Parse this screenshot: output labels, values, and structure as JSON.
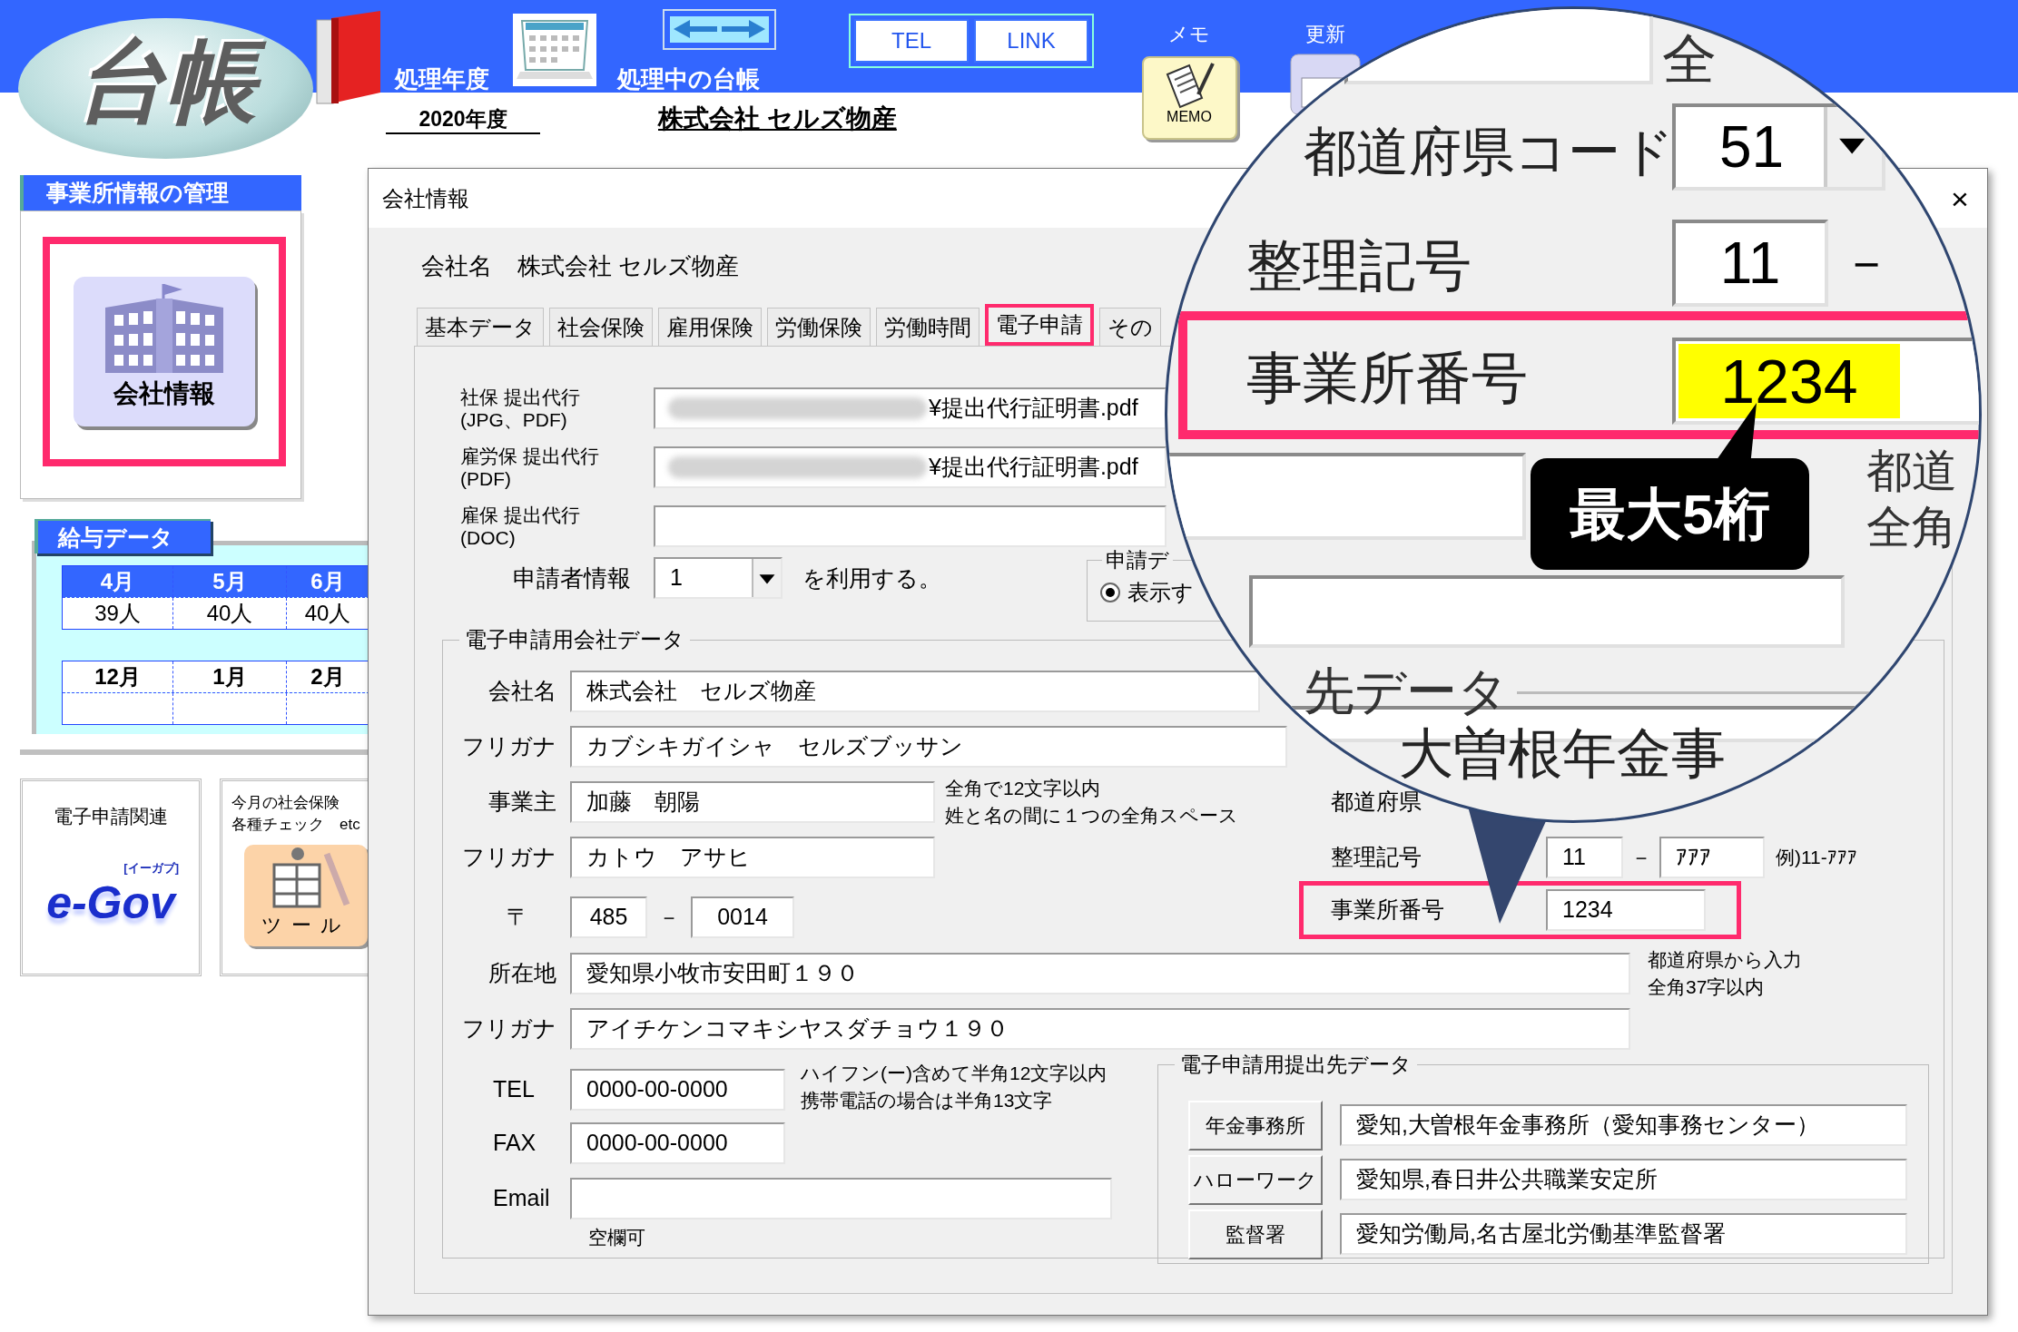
{
  "app_bar": {
    "logo": "台帳",
    "year_label": "処理年度",
    "year": "2020年度",
    "ledger_label": "処理中の台帳",
    "ledger": "株式会社 セルズ物産",
    "buttons": [
      "TEL",
      "LINK"
    ],
    "memo_label": "メモ",
    "memo_icon_text": "MEMO",
    "update_label": "更新"
  },
  "sidebar": {
    "office": {
      "title": "事業所情報の管理",
      "button": "会社情報",
      "highlighted": true
    },
    "salary": {
      "title": "給与データ",
      "tables": [
        {
          "months": [
            "4月",
            "5月",
            "6月"
          ],
          "counts": [
            "39人",
            "40人",
            "40人"
          ]
        },
        {
          "months": [
            "12月",
            "1月",
            "2月"
          ]
        }
      ]
    },
    "tiles": [
      {
        "kind": "egov",
        "caption": "電子申請関連",
        "logo": "e-Gov",
        "logo_note": "[イーガブ]"
      },
      {
        "kind": "tool",
        "lines": [
          "今月の社会保険",
          "各種チェック　etc"
        ],
        "icon_label": "ツール"
      }
    ]
  },
  "dialog": {
    "title": "会社情報",
    "close": "×",
    "company_label": "会社名",
    "company_name": "株式会社 セルズ物産",
    "tabs": [
      {
        "label": "基本データ",
        "selected": false
      },
      {
        "label": "社会保険",
        "selected": false
      },
      {
        "label": "雇用保険",
        "selected": false
      },
      {
        "label": "労働保険",
        "selected": false
      },
      {
        "label": "労働時間",
        "selected": false
      },
      {
        "label": "電子申請",
        "selected": true
      },
      {
        "label": "その",
        "selected": false
      }
    ],
    "proxy_files": [
      {
        "label": "社保 提出代行",
        "sub": "(JPG、PDF)",
        "value": "¥提出代行証明書.pdf",
        "redacted": true
      },
      {
        "label": "雇労保 提出代行",
        "sub": "(PDF)",
        "value": "¥提出代行証明書.pdf",
        "redacted": true
      },
      {
        "label": "雇保 提出代行",
        "sub": "(DOC)",
        "redacted": false
      }
    ],
    "applicant": {
      "label": "申請者情報",
      "value": "1",
      "suffix": "を利用する。"
    },
    "display_group": {
      "title": "申請デ",
      "option": "表示す",
      "selected": true
    },
    "company_data": {
      "title": "電子申請用会社データ",
      "name": {
        "label": "会社名",
        "value": "株式会社　セルズ物産"
      },
      "name_kana": {
        "label": "フリガナ",
        "value": "カブシキガイシャ　セルズブッサン"
      },
      "owner": {
        "label": "事業主",
        "value": "加藤　朝陽",
        "notes": [
          "全角で12文字以内",
          "姓と名の間に１つの全角スペース"
        ]
      },
      "owner_kana": {
        "label": "フリガナ",
        "value": "カトウ　アサヒ"
      },
      "postal": {
        "label": "〒",
        "first": "485",
        "separator": "－",
        "second": "0014"
      },
      "address": {
        "label": "所在地",
        "value": "愛知県小牧市安田町１９０",
        "notes": [
          "都道府県から入力",
          "全角37字以内"
        ]
      },
      "address_kana": {
        "label": "フリガナ",
        "value": "アイチケンコマキシヤスダチョウ１９０"
      },
      "tel": {
        "label": "TEL",
        "value": "0000-00-0000",
        "notes": [
          "ハイフン(ー)含めて半角12文字以内",
          "携帯電話の場合は半角13文字"
        ]
      },
      "fax": {
        "label": "FAX",
        "value": "0000-00-0000"
      },
      "email": {
        "label": "Email",
        "note": "空欄可"
      },
      "office": {
        "prefecture_label": "都道府県",
        "ref_label": "整理記号",
        "ref_first": "11",
        "separator": "－",
        "ref_second": "ｱｱｱ",
        "ref_example": "例)11-ｱｱｱ",
        "number_label": "事業所番号",
        "number": "1234",
        "highlighted": true
      },
      "submission": {
        "title": "電子申請用提出先データ",
        "rows": [
          {
            "button": "年金事務所",
            "value": "愛知,大曽根年金事務所（愛知事務センター）"
          },
          {
            "button": "ハローワーク",
            "value": "愛知県,春日井公共職業安定所"
          },
          {
            "button": "監督署",
            "value": "愛知労働局,名古屋北労働基準監督署"
          }
        ]
      }
    }
  },
  "magnifier": {
    "top_text": "全",
    "prefecture_code_label": "都道府県コード",
    "prefecture_code": "51",
    "ref_label": "整理記号",
    "ref_first": "11",
    "separator": "－",
    "number_label": "事業所番号",
    "number": "1234",
    "number_selected": true,
    "highlighted": true,
    "callout": "最大5桁",
    "side_lines": [
      "都道",
      "全角"
    ],
    "group_title": "先データ",
    "bottom_text": "大曽根年金事"
  }
}
